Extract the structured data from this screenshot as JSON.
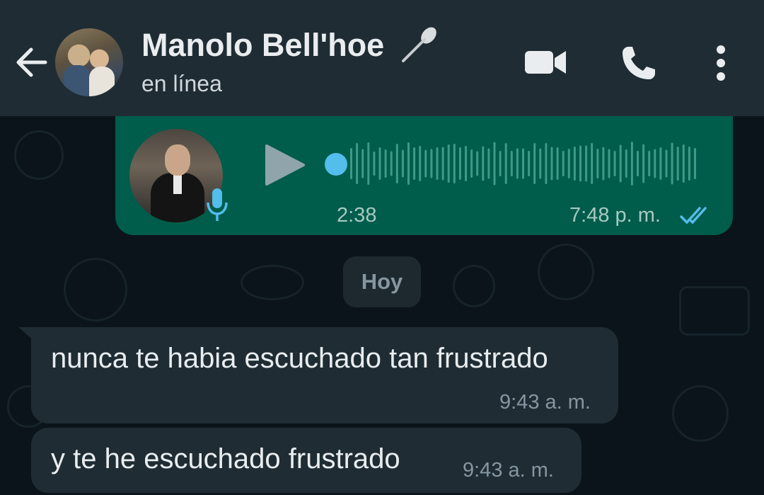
{
  "header": {
    "contact_name": "Manolo Bell'hoe",
    "status": "en línea"
  },
  "voice_message": {
    "duration": "2:38",
    "time": "7:48 p. m.",
    "status": "read"
  },
  "date_chip": "Hoy",
  "messages": [
    {
      "text": "nunca te habia escuchado tan frustrado",
      "time": "9:43 a. m."
    },
    {
      "text": "y te he escuchado frustrado",
      "time": "9:43 a. m."
    }
  ],
  "colors": {
    "header_bg": "#1f2c34",
    "chat_bg": "#0b141a",
    "outgoing_bubble": "#005c4b",
    "incoming_bubble": "#1f2c34",
    "accent_blue": "#53bdeb"
  },
  "icons": [
    "arrow-back-icon",
    "spoon-icon",
    "video-camera-icon",
    "phone-icon",
    "more-vert-icon",
    "mic-icon",
    "play-icon",
    "double-check-icon"
  ]
}
